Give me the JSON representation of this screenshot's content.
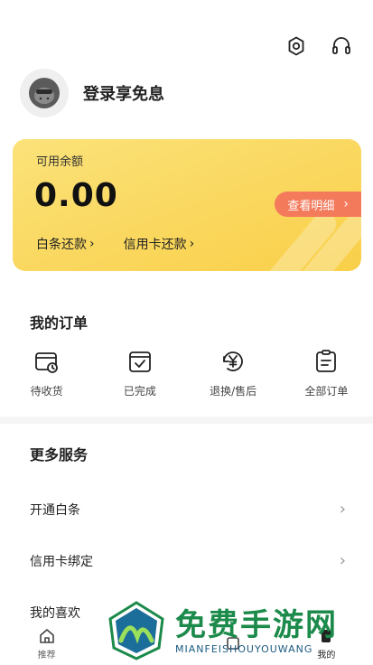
{
  "header": {
    "icons": [
      "settings-icon",
      "headset-icon"
    ]
  },
  "profile": {
    "login_text": "登录享免息"
  },
  "balance_card": {
    "label": "可用余额",
    "value": "0.00",
    "detail_button": "查看明细",
    "links": [
      "白条还款",
      "信用卡还款"
    ]
  },
  "orders": {
    "title": "我的订单",
    "items": [
      {
        "label": "待收货",
        "icon": "wallet-clock-icon"
      },
      {
        "label": "已完成",
        "icon": "bag-check-icon"
      },
      {
        "label": "退换/售后",
        "icon": "yen-refresh-icon"
      },
      {
        "label": "全部订单",
        "icon": "clipboard-icon"
      }
    ]
  },
  "services": {
    "title": "更多服务",
    "items": [
      {
        "label": "开通白条"
      },
      {
        "label": "信用卡绑定"
      },
      {
        "label": "我的喜欢"
      }
    ]
  },
  "bottom_nav": {
    "tabs": [
      {
        "label": "推荐",
        "icon": "home-icon"
      },
      {
        "label": "",
        "icon": "category-icon"
      },
      {
        "label": "",
        "icon": "cart-icon"
      },
      {
        "label": "我的",
        "icon": "profile-icon"
      }
    ]
  },
  "watermark": {
    "cn": "免费手游网",
    "en": "MIANFEISHOUYOUWANG"
  },
  "colors": {
    "card_gradient_start": "#fbe27a",
    "card_gradient_end": "#f9cf48",
    "detail_button": "#f47a5c",
    "watermark_green": "#1b8a4a"
  }
}
